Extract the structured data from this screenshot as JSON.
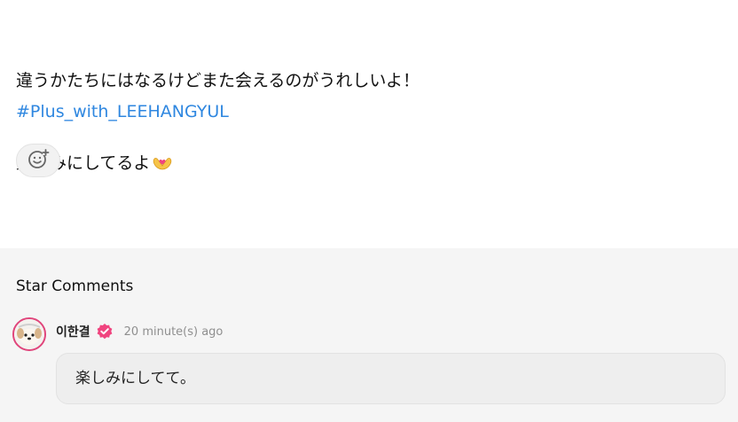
{
  "post": {
    "lines": [
      "違うかたちにはなるけどまた会えるのがうれしいよ！",
      "楽しみにしてるよ"
    ],
    "hashtag": "#Plus_with_LEEHANGYUL"
  },
  "icons": {
    "inline_emoji": "heart-hands-emoji",
    "reaction": "add-reaction-icon",
    "verified": "verified-badge-icon",
    "avatar": "dog-avatar"
  },
  "comments": {
    "title": "Star Comments",
    "items": [
      {
        "author": "이한결",
        "time": "20 minute(s) ago",
        "text": "楽しみにしてて。"
      }
    ]
  },
  "colors": {
    "hashtag": "#2f87e0",
    "verified": "#f0447f",
    "comments_bg": "#f5f5f5",
    "bubble_bg": "#eeeeee"
  }
}
